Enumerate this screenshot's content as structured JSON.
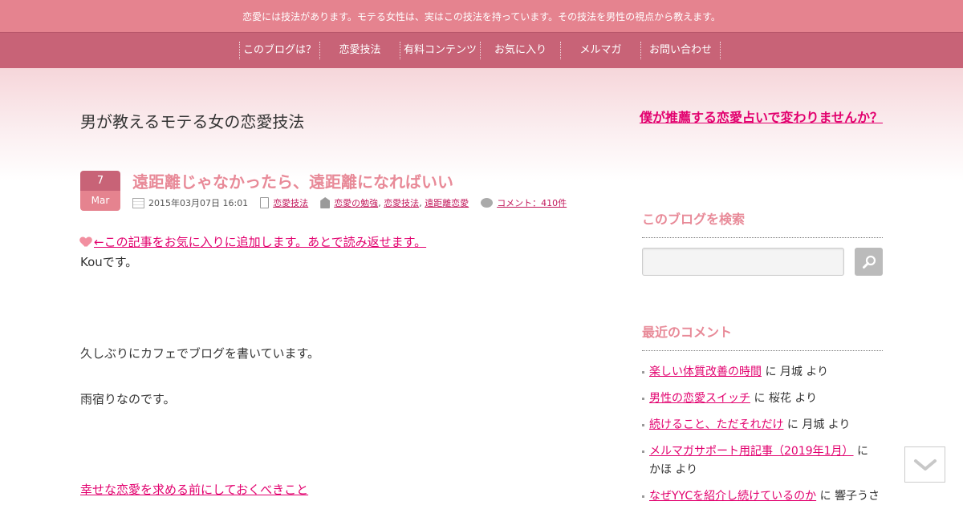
{
  "header": {
    "tagline": "恋愛には技法があります。モテる女性は、実はこの技法を持っています。その技法を男性の視点から教えます。",
    "nav": [
      "このブログは？",
      "恋愛技法",
      "有料コンテンツ",
      "お気に入り",
      "メルマガ",
      "お問い合わせ"
    ]
  },
  "site": {
    "title": "男が教えるモテる女の恋愛技法",
    "promo_link": "僕が推薦する恋愛占いで変わりませんか？"
  },
  "post": {
    "date_day": "7",
    "date_month": "Mar",
    "title": "遠距離じゃなかったら、遠距離になればいい",
    "meta": {
      "datetime": "2015年03月07日 16:01",
      "category": "恋愛技法",
      "tags": [
        "恋愛の勉強",
        "恋愛技法",
        "遠距離恋愛"
      ],
      "tag_sep": ",",
      "comments": "コメント：410件"
    },
    "fav_link": "←この記事をお気に入りに追加します。あとで読み返せます。",
    "p1": "Kouです。",
    "p2": "久しぶりにカフェでブログを書いています。",
    "p3": "雨宿りなのです。",
    "link": "幸せな恋愛を求める前にしておくべきこと"
  },
  "sidebar": {
    "search_heading": "このブログを検索",
    "search_placeholder": "",
    "comments_heading": "最近のコメント",
    "comments": [
      {
        "title": "楽しい体質改善の時間",
        "author": "に 月城 より"
      },
      {
        "title": "男性の恋愛スイッチ",
        "author": "に 桜花 より"
      },
      {
        "title": "続けること、ただそれだけ",
        "author": "に 月城 より"
      },
      {
        "title": "メルマガサポート用記事（2019年1月）",
        "author": "に かほ より"
      },
      {
        "title": "なぜYYCを紹介し続けているのか",
        "author": "に 響子うさ"
      }
    ]
  },
  "colors": {
    "topbar": "#e5838f",
    "navbar": "#c86377",
    "link": "#e2006e",
    "heading": "#e88a98"
  }
}
